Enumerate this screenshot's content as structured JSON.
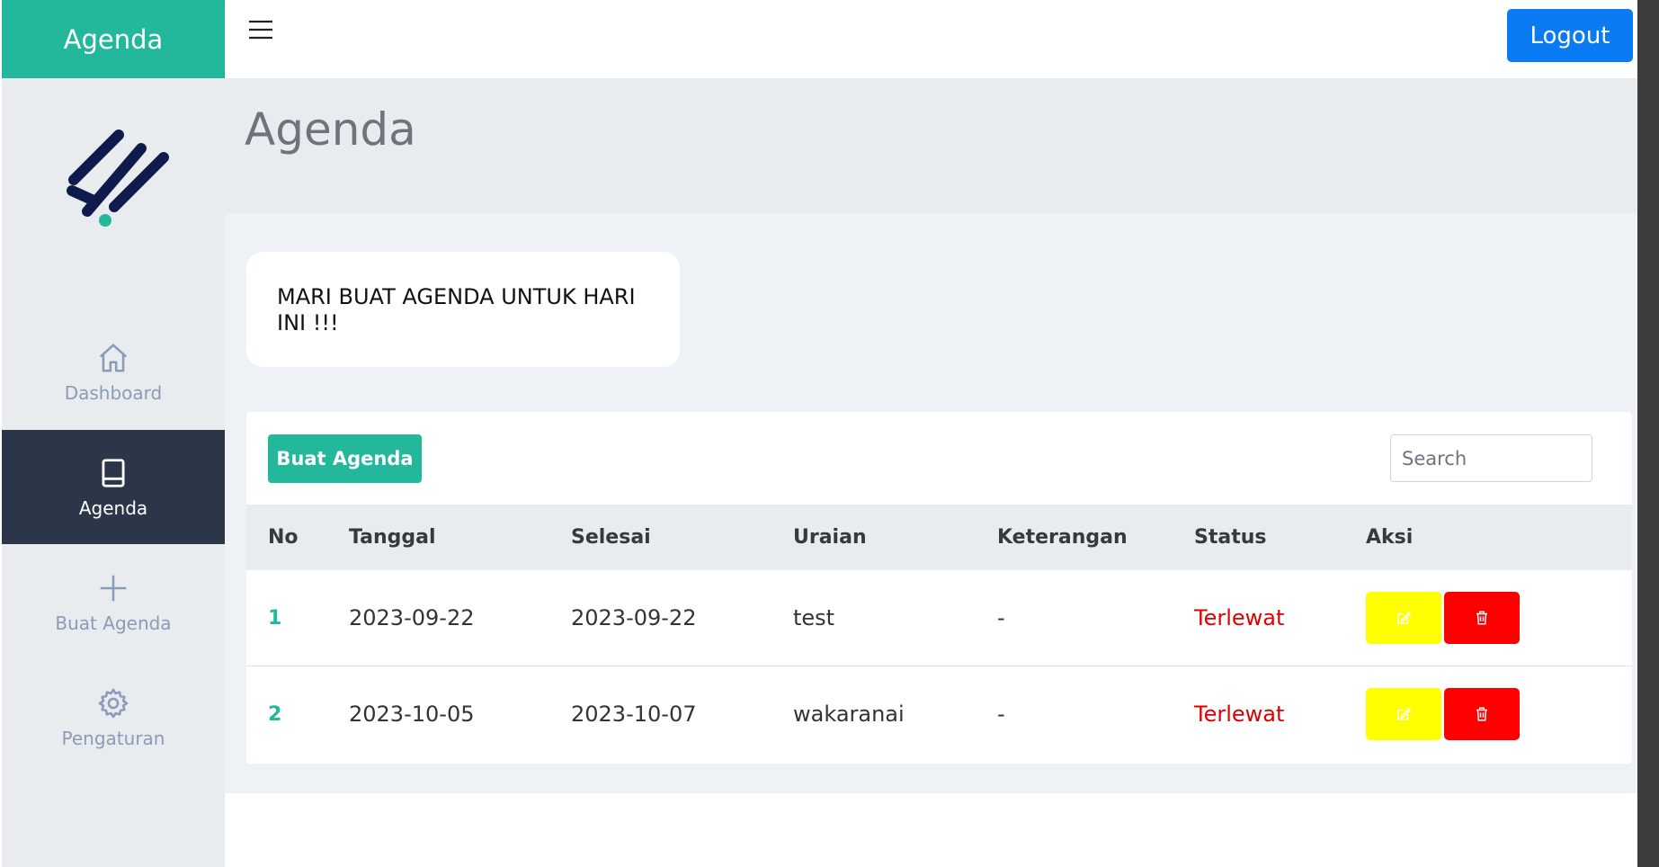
{
  "brand": {
    "title": "Agenda"
  },
  "topbar": {
    "menu_icon": "hamburger-icon",
    "logout_label": "Logout"
  },
  "sidebar": {
    "logo": "brand-logo",
    "items": [
      {
        "label": "Dashboard",
        "icon": "home-icon",
        "active": false
      },
      {
        "label": "Agenda",
        "icon": "book-icon",
        "active": true
      },
      {
        "label": "Buat Agenda",
        "icon": "plus-icon",
        "active": false
      },
      {
        "label": "Pengaturan",
        "icon": "gear-icon",
        "active": false
      }
    ]
  },
  "page": {
    "title": "Agenda"
  },
  "banner": {
    "text": "MARI BUAT AGENDA UNTUK HARI INI !!!"
  },
  "toolbar": {
    "create_label": "Buat Agenda",
    "search_placeholder": "Search"
  },
  "table": {
    "headers": {
      "no": "No",
      "tanggal": "Tanggal",
      "selesai": "Selesai",
      "uraian": "Uraian",
      "keterangan": "Keterangan",
      "status": "Status",
      "aksi": "Aksi"
    },
    "rows": [
      {
        "no": "1",
        "tanggal": "2023-09-22",
        "selesai": "2023-09-22",
        "uraian": "test",
        "keterangan": "-",
        "status": "Terlewat"
      },
      {
        "no": "2",
        "tanggal": "2023-10-05",
        "selesai": "2023-10-07",
        "uraian": "wakaranai",
        "keterangan": "-",
        "status": "Terlewat"
      }
    ]
  },
  "colors": {
    "accent": "#23b79c",
    "sidebar_active": "#2b3649",
    "logout": "#0a7bf2",
    "edit": "#ffff00",
    "delete": "#ff0000",
    "status_overdue": "#e00000"
  }
}
